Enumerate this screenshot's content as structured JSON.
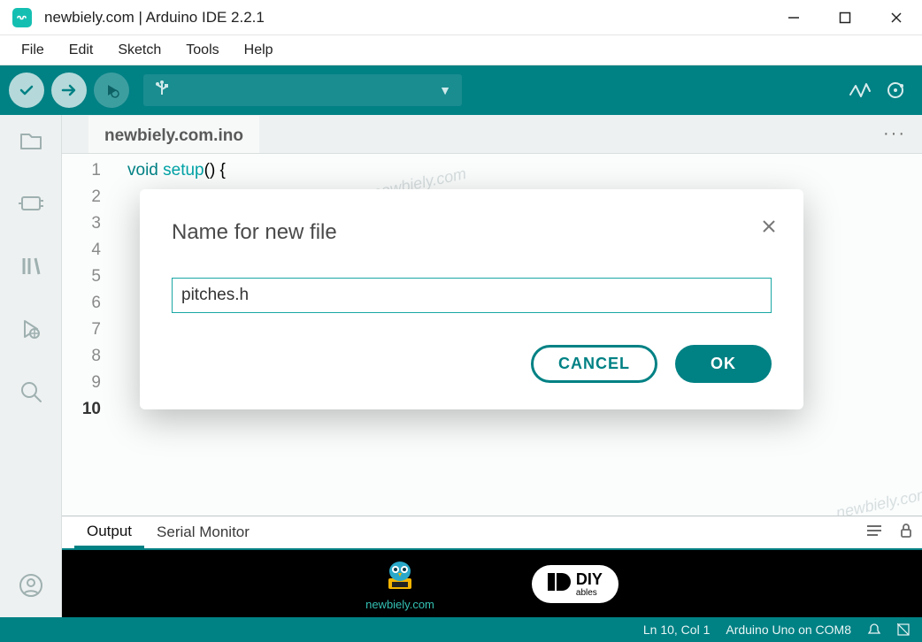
{
  "window": {
    "title": "newbiely.com | Arduino IDE 2.2.1"
  },
  "menubar": {
    "items": [
      "File",
      "Edit",
      "Sketch",
      "Tools",
      "Help"
    ]
  },
  "toolbar": {
    "board_usb_glyph": "⇅",
    "icons": {
      "verify": "verify-icon",
      "upload": "upload-icon",
      "debug": "debug-icon",
      "serial_plotter": "serial-plotter-icon",
      "serial_monitor": "serial-monitor-icon"
    }
  },
  "sidebar": {
    "icons": [
      "folder-icon",
      "boards-icon",
      "library-icon",
      "debug-icon",
      "search-icon",
      "profile-icon"
    ]
  },
  "tabs": {
    "active": "newbiely.com.ino",
    "more": "···"
  },
  "code": {
    "gutter_start": 1,
    "gutter_end": 10,
    "line1_kw": "void",
    "line1_fn": " setup",
    "line1_rest": "() {"
  },
  "watermarks": [
    "newbiely.com",
    "newbiely.com",
    "newbiely.com",
    "newbiely.com"
  ],
  "panel": {
    "output_label": "Output",
    "serial_label": "Serial Monitor"
  },
  "brands": {
    "owl_text": "newbiely.com",
    "diy_big": "DIY",
    "diy_small": "ables"
  },
  "statusbar": {
    "pos": "Ln 10, Col 1",
    "board": "Arduino Uno on COM8"
  },
  "modal": {
    "title": "Name for new file",
    "input_value": "pitches.h",
    "cancel": "CANCEL",
    "ok": "OK"
  }
}
